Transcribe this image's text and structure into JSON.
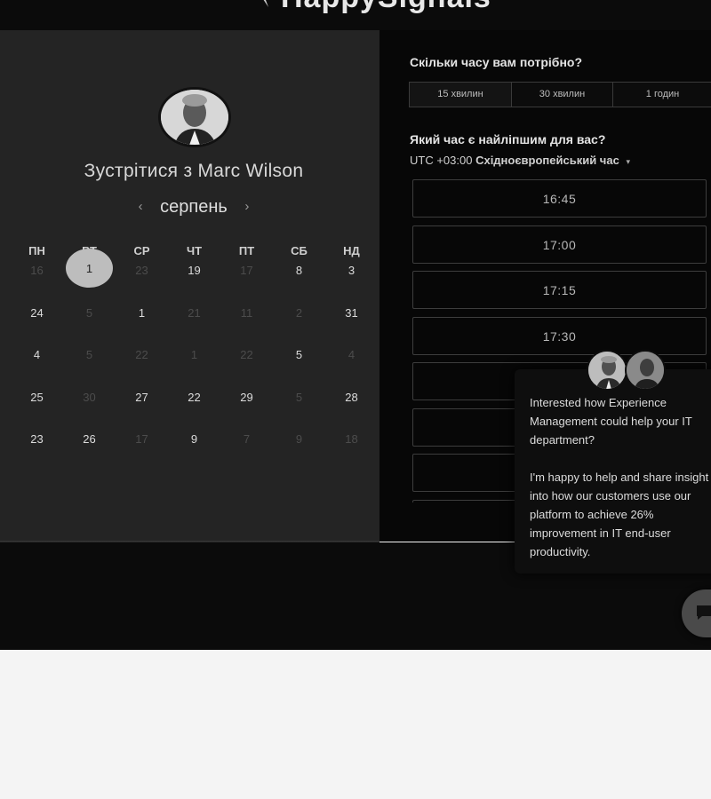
{
  "brand": {
    "name": "HappySignals"
  },
  "left": {
    "title": "Зустрітися з Marc Wilson",
    "month": "серпень",
    "prev_arrow": "‹",
    "next_arrow": "›",
    "weekdays": [
      "ПН",
      "ВТ",
      "СР",
      "ЧТ",
      "ПТ",
      "СБ",
      "НД"
    ],
    "weeks": [
      [
        {
          "d": "16",
          "s": "dis"
        },
        {
          "d": "1",
          "s": "sel"
        },
        {
          "d": "23",
          "s": "dis"
        },
        {
          "d": "19",
          "s": "avail"
        },
        {
          "d": "17",
          "s": "dis"
        },
        {
          "d": "8",
          "s": "avail"
        },
        {
          "d": "3",
          "s": "avail"
        }
      ],
      [
        {
          "d": "24",
          "s": "avail"
        },
        {
          "d": "5",
          "s": "dis"
        },
        {
          "d": "1",
          "s": "avail"
        },
        {
          "d": "21",
          "s": "dis"
        },
        {
          "d": "11",
          "s": "dis"
        },
        {
          "d": "2",
          "s": "dis"
        },
        {
          "d": "31",
          "s": "avail"
        }
      ],
      [
        {
          "d": "4",
          "s": "avail"
        },
        {
          "d": "5",
          "s": "dis"
        },
        {
          "d": "22",
          "s": "dis"
        },
        {
          "d": "1",
          "s": "dis"
        },
        {
          "d": "22",
          "s": "dis"
        },
        {
          "d": "5",
          "s": "avail"
        },
        {
          "d": "4",
          "s": "dis"
        }
      ],
      [
        {
          "d": "25",
          "s": "avail"
        },
        {
          "d": "30",
          "s": "dis"
        },
        {
          "d": "27",
          "s": "avail"
        },
        {
          "d": "22",
          "s": "avail"
        },
        {
          "d": "29",
          "s": "avail"
        },
        {
          "d": "5",
          "s": "dis"
        },
        {
          "d": "28",
          "s": "avail"
        }
      ],
      [
        {
          "d": "23",
          "s": "avail"
        },
        {
          "d": "26",
          "s": "avail"
        },
        {
          "d": "17",
          "s": "dis"
        },
        {
          "d": "9",
          "s": "avail"
        },
        {
          "d": "7",
          "s": "dis"
        },
        {
          "d": "9",
          "s": "dis"
        },
        {
          "d": "18",
          "s": "dis"
        }
      ]
    ]
  },
  "right": {
    "duration_label": "Скільки часу вам потрібно?",
    "durations": [
      "15 хвилин",
      "30 хвилин",
      "1 годин"
    ],
    "time_label": "Який час є найліпшим для вас?",
    "timezone_offset": "UTC +03:00",
    "timezone_name": "Східноєвропейський час",
    "timezone_caret": "▾",
    "slots": [
      "16:45",
      "17:00",
      "17:15",
      "17:30",
      "",
      "",
      "",
      ""
    ]
  },
  "popup": {
    "paragraph1": "Interested how Experience Management could help your IT department?",
    "paragraph2": "I'm happy to help and share insight into how our customers use our platform to achieve 26% improvement in IT end-user productivity."
  },
  "colors": {
    "page_bg": "#f4f4f4",
    "left_panel": "#242424",
    "right_panel": "#070707",
    "selected_day": "#bdbdbd"
  },
  "icons": {
    "logo": "speech-bubble-logo-icon",
    "chat": "chat-bubble-icon"
  }
}
